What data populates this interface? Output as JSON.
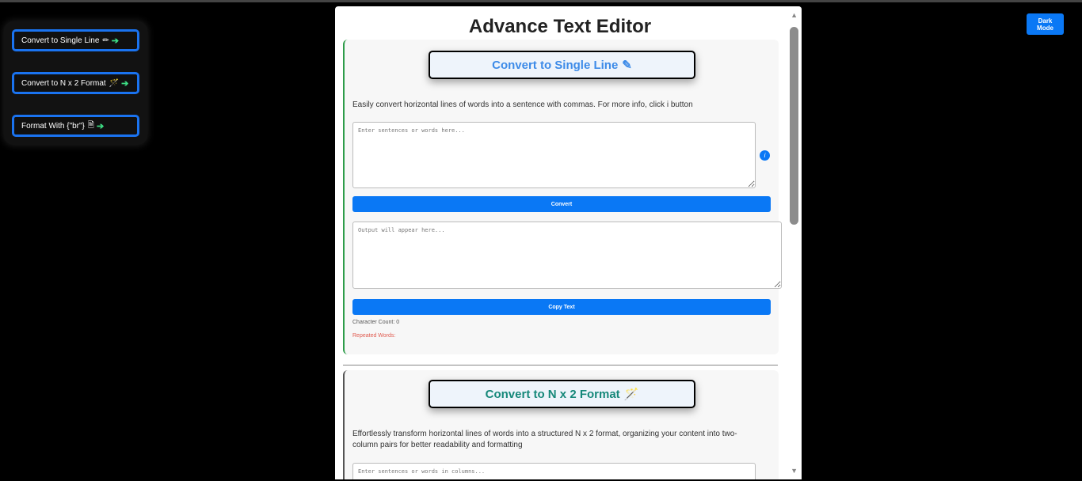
{
  "sidebar": {
    "items": [
      {
        "label": "Convert to Single Line",
        "icon": "pencil-icon",
        "icon_glyph": "✏"
      },
      {
        "label": "Convert to N x 2 Format",
        "icon": "magic-wand-icon",
        "icon_glyph": "🪄"
      },
      {
        "label": "Format With {\"br\"}",
        "icon": "file-icon",
        "icon_glyph": "🗎"
      }
    ],
    "arrow_glyph": "➔"
  },
  "dark_mode": {
    "label": "Dark Mode"
  },
  "page_title": "Advance Text Editor",
  "sections": [
    {
      "heading": "Convert to Single Line",
      "heading_icon": "pencil-icon",
      "heading_glyph": "✎",
      "description": "Easily convert horizontal lines of words into a sentence with commas. For more info, click i button",
      "input_placeholder": "Enter sentences or words here...",
      "info_glyph": "i",
      "convert_label": "Convert",
      "output_placeholder": "Output will appear here...",
      "copy_label": "Copy Text",
      "character_count": "Character Count: 0",
      "repeated_words": "Repeated Words:"
    },
    {
      "heading": "Convert to N x 2 Format",
      "heading_icon": "magic-wand-icon",
      "heading_glyph": "🪄",
      "description": "Effortlessly transform horizontal lines of words into a structured N x 2 format, organizing your content into two-column pairs for better readability and formatting",
      "input_placeholder": "Enter sentences or words in columns..."
    }
  ],
  "scrollbar": {
    "up_glyph": "▲",
    "down_glyph": "▼"
  },
  "colors": {
    "accent": "#0a78f5",
    "green_border": "#2e9c4a",
    "heading_blue": "#3d8be8",
    "heading_teal": "#16887a",
    "repeated_red": "#e05a4f"
  }
}
